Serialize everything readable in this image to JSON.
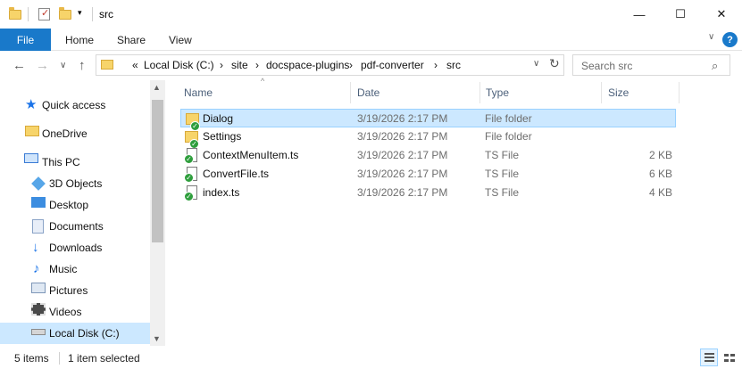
{
  "window": {
    "title": "src",
    "minimize": "—",
    "maximize": "☐",
    "close": "✕",
    "qa_dropdown": "▾"
  },
  "ribbon": {
    "tabs": [
      "File",
      "Home",
      "Share",
      "View"
    ],
    "collapse_icon": "∨",
    "help_icon": "?"
  },
  "nav": {
    "back": "←",
    "forward": "→",
    "recent": "∨",
    "up": "↑",
    "breadcrumb_prefix": "«",
    "breadcrumb": [
      "Local Disk (C:)",
      "site",
      "docspace-plugins",
      "pdf-converter",
      "src"
    ],
    "separator": "›",
    "address_dropdown": "∨",
    "refresh": "↻",
    "search_placeholder": "Search src",
    "search_icon": "⌕"
  },
  "sidebar": {
    "items": [
      {
        "label": "Quick access",
        "icon": "star-icon"
      },
      {
        "label": "OneDrive",
        "icon": "onedrive-folder-icon"
      },
      {
        "label": "This PC",
        "icon": "computer-icon"
      },
      {
        "label": "3D Objects",
        "icon": "3d-objects-icon"
      },
      {
        "label": "Desktop",
        "icon": "desktop-icon"
      },
      {
        "label": "Documents",
        "icon": "documents-icon"
      },
      {
        "label": "Downloads",
        "icon": "downloads-icon"
      },
      {
        "label": "Music",
        "icon": "music-icon"
      },
      {
        "label": "Pictures",
        "icon": "pictures-icon"
      },
      {
        "label": "Videos",
        "icon": "videos-icon"
      },
      {
        "label": "Local Disk (C:)",
        "icon": "local-disk-icon"
      }
    ],
    "scroll_up": "▲",
    "scroll_down": "▼"
  },
  "columns": {
    "name": "Name",
    "date": "Date",
    "type": "Type",
    "size": "Size",
    "sort_indicator": "^"
  },
  "files": [
    {
      "name": "Dialog",
      "date": "3/19/2026 2:17 PM",
      "type": "File folder",
      "size": "",
      "kind": "folder"
    },
    {
      "name": "Settings",
      "date": "3/19/2026 2:17 PM",
      "type": "File folder",
      "size": "",
      "kind": "folder"
    },
    {
      "name": "ContextMenuItem.ts",
      "date": "3/19/2026 2:17 PM",
      "type": "TS File",
      "size": "2 KB",
      "kind": "ts"
    },
    {
      "name": "ConvertFile.ts",
      "date": "3/19/2026 2:17 PM",
      "type": "TS File",
      "size": "6 KB",
      "kind": "ts"
    },
    {
      "name": "index.ts",
      "date": "3/19/2026 2:17 PM",
      "type": "TS File",
      "size": "4 KB",
      "kind": "ts"
    }
  ],
  "status": {
    "item_count": "5 items",
    "selection": "1 item selected"
  }
}
